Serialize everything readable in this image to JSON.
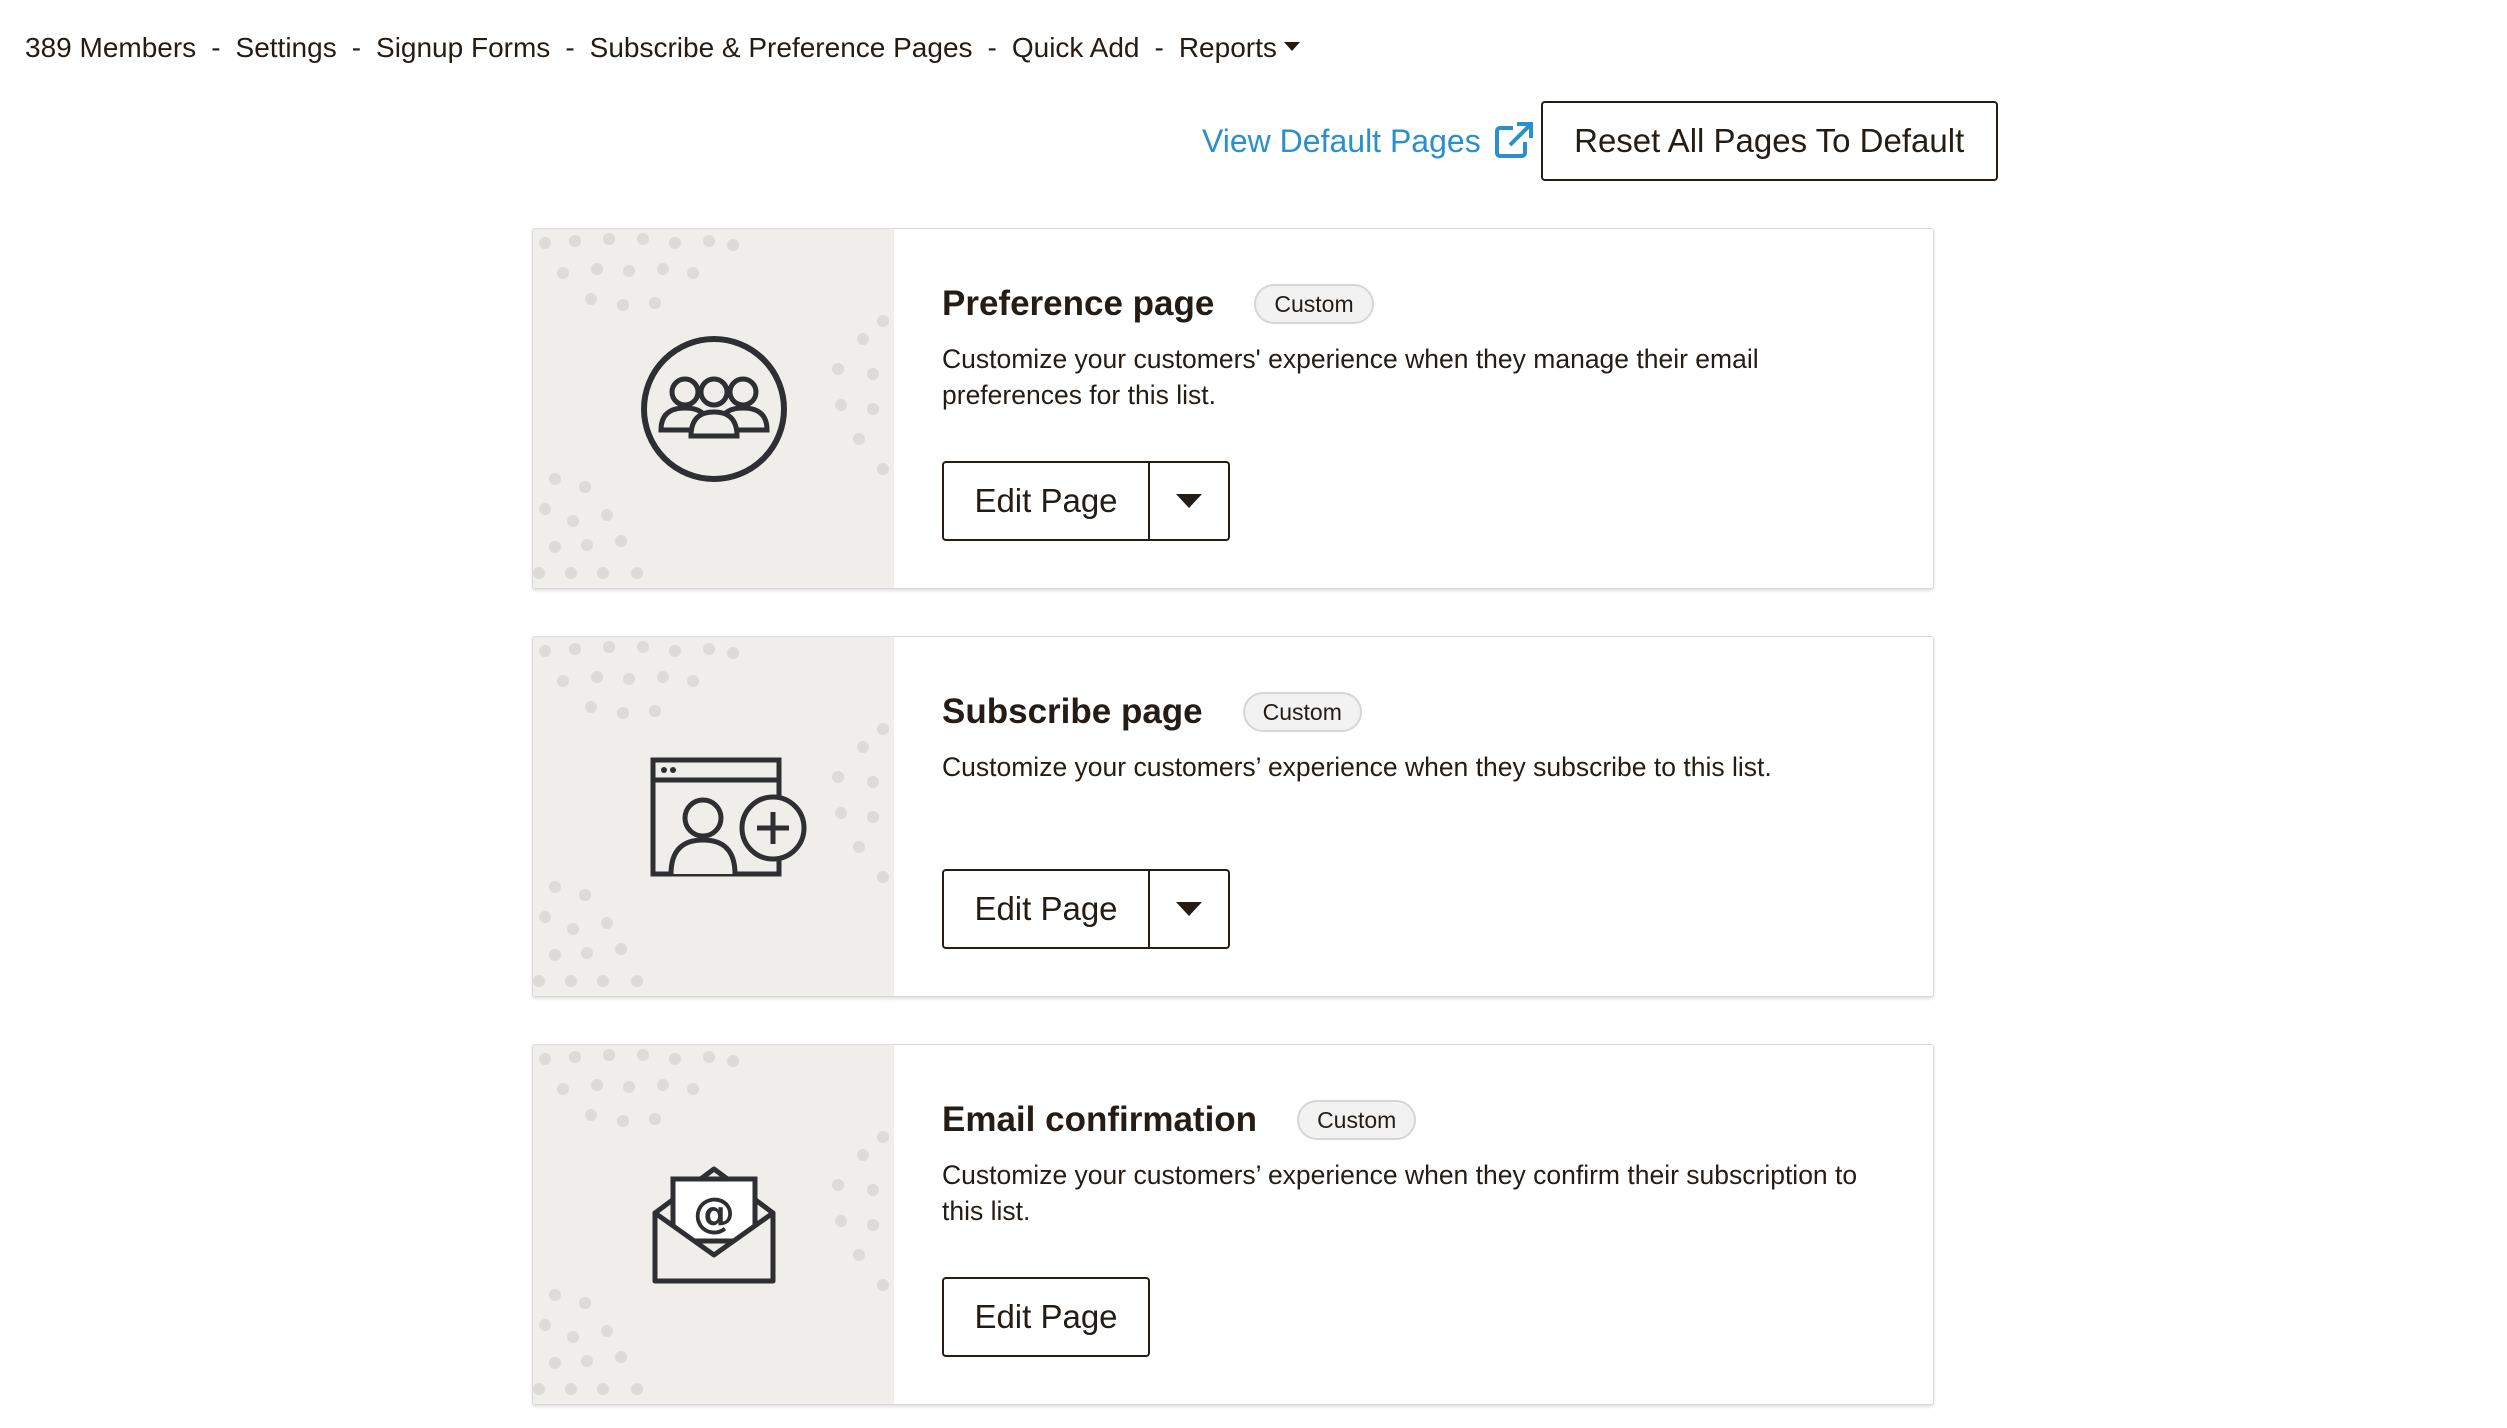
{
  "nav": {
    "items": [
      "389 Members",
      "Settings",
      "Signup Forms",
      "Subscribe & Preference Pages",
      "Quick Add",
      "Reports"
    ],
    "separator": "-"
  },
  "actions": {
    "view_default_label": "View Default Pages",
    "reset_label": "Reset All Pages To Default"
  },
  "cards": [
    {
      "title": "Preference page",
      "badge": "Custom",
      "description": "Customize your customers' experience when they manage their email preferences for this list.",
      "edit_label": "Edit Page",
      "has_dropdown": true,
      "icon": "group-icon"
    },
    {
      "title": "Subscribe page",
      "badge": "Custom",
      "description": "Customize your customers’ experience when they subscribe to this list.",
      "edit_label": "Edit Page",
      "has_dropdown": true,
      "icon": "add-user-window-icon"
    },
    {
      "title": "Email confirmation",
      "badge": "Custom",
      "description": "Customize your customers’ experience when they confirm their subscription to this list.",
      "edit_label": "Edit Page",
      "has_dropdown": false,
      "icon": "email-envelope-icon"
    }
  ],
  "colors": {
    "link": "#2a8fcc",
    "text": "#241c15",
    "art_bg": "#efeeea"
  }
}
